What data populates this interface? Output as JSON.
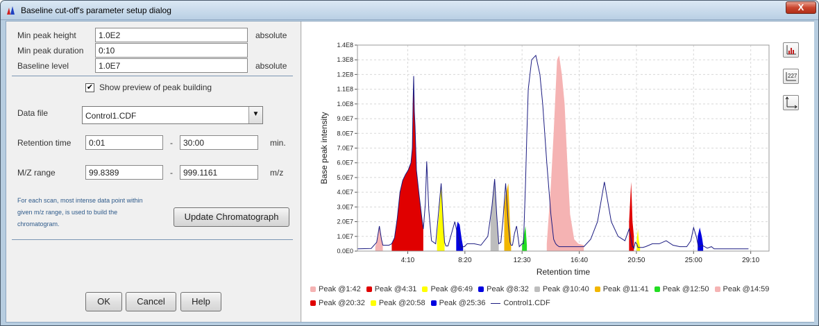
{
  "window": {
    "title": "Baseline cut-off's parameter setup dialog",
    "close_label": "X"
  },
  "form": {
    "min_peak_height": {
      "label": "Min peak height",
      "value": "1.0E2",
      "unit": "absolute"
    },
    "min_peak_duration": {
      "label": "Min peak duration",
      "value": "0:10"
    },
    "baseline_level": {
      "label": "Baseline level",
      "value": "1.0E7",
      "unit": "absolute"
    },
    "show_preview": {
      "label": "Show preview of peak building",
      "checked": true
    },
    "data_file": {
      "label": "Data file",
      "value": "Control1.CDF"
    },
    "retention_time": {
      "label": "Retention time",
      "from": "0:01",
      "sep": "-",
      "to": "30:00",
      "unit": "min."
    },
    "mz_range": {
      "label": "M/Z range",
      "from": "99.8389",
      "sep": "-",
      "to": "999.1161",
      "unit": "m/z"
    },
    "note": "For each scan, most intense data point within given m/z range, is used to build the chromatogram.",
    "update_button": "Update Chromatograph"
  },
  "buttons": {
    "ok": "OK",
    "cancel": "Cancel",
    "help": "Help"
  },
  "toolbar": {
    "icons": [
      "peak-labels-icon",
      "data-labels-icon",
      "axes-icon"
    ],
    "data_label_text": "227"
  },
  "chart_data": {
    "type": "area",
    "xlabel": "Retention time",
    "ylabel": "Base peak intensity",
    "xlim": [
      0.5,
      30.5
    ],
    "ylim": [
      0,
      140000000
    ],
    "x_ticks": [
      {
        "v": 4.167,
        "label": "4:10"
      },
      {
        "v": 8.333,
        "label": "8:20"
      },
      {
        "v": 12.5,
        "label": "12:30"
      },
      {
        "v": 16.667,
        "label": "16:40"
      },
      {
        "v": 20.833,
        "label": "20:50"
      },
      {
        "v": 25.0,
        "label": "25:00"
      },
      {
        "v": 29.167,
        "label": "29:10"
      }
    ],
    "y_ticks": [
      "0.0E0",
      "1.0E7",
      "2.0E7",
      "3.0E7",
      "4.0E7",
      "5.0E7",
      "6.0E7",
      "7.0E7",
      "8.0E7",
      "9.0E7",
      "1.0E8",
      "1.1E8",
      "1.2E8",
      "1.3E8",
      "1.4E8"
    ],
    "line_series": {
      "name": "Control1.CDF",
      "color": "#1a1a80",
      "x": [
        0.5,
        1.5,
        1.9,
        2.1,
        2.25,
        2.35,
        2.5,
        2.8,
        3.0,
        3.2,
        3.4,
        3.6,
        3.8,
        4.0,
        4.2,
        4.4,
        4.5,
        4.55,
        4.6,
        4.65,
        4.7,
        4.8,
        5.0,
        5.2,
        5.3,
        5.45,
        5.55,
        5.7,
        5.9,
        6.2,
        6.4,
        6.6,
        6.75,
        6.85,
        6.95,
        7.1,
        7.3,
        7.6,
        7.8,
        8.0,
        8.1,
        8.2,
        8.3,
        8.5,
        9.0,
        9.5,
        10.0,
        10.3,
        10.5,
        10.65,
        10.8,
        10.95,
        11.1,
        11.3,
        11.5,
        11.62,
        11.7,
        11.8,
        11.95,
        12.1,
        12.3,
        12.5,
        12.6,
        12.75,
        12.85,
        12.95,
        13.2,
        13.5,
        13.8,
        14.0,
        14.3,
        14.6,
        14.8,
        14.95,
        15.05,
        15.2,
        15.4,
        15.6,
        15.8,
        16.0,
        16.3,
        16.6,
        17.0,
        17.5,
        18.0,
        18.5,
        19.0,
        19.5,
        20.0,
        20.3,
        20.45,
        20.55,
        20.6,
        20.65,
        20.75,
        20.85,
        20.95,
        21.0,
        21.1,
        21.3,
        21.5,
        22.0,
        22.5,
        23.0,
        23.5,
        24.0,
        24.5,
        24.8,
        25.0,
        25.2,
        25.35,
        25.45,
        25.6,
        25.8,
        26.0,
        26.3,
        26.5,
        27.0,
        27.5,
        28.0,
        28.5,
        29.0,
        29.5,
        30.0,
        30.5
      ],
      "y": [
        1500000,
        1800000,
        6000000,
        17000000,
        8000000,
        4000000,
        4000000,
        4000000,
        5000000,
        9000000,
        22000000,
        40000000,
        48000000,
        52000000,
        55000000,
        60000000,
        70000000,
        100000000,
        119000000,
        95000000,
        85000000,
        55000000,
        38000000,
        22000000,
        15000000,
        32000000,
        61000000,
        28000000,
        7000000,
        5000000,
        25000000,
        46000000,
        20000000,
        6000000,
        3500000,
        3500000,
        10000000,
        20000000,
        11000000,
        3000000,
        2000000,
        3000000,
        3000000,
        5000000,
        5000000,
        4000000,
        10000000,
        30000000,
        49000000,
        25000000,
        5000000,
        6000000,
        20000000,
        46000000,
        18000000,
        6000000,
        4000000,
        4000000,
        12000000,
        17000000,
        3000000,
        5000000,
        5000000,
        45000000,
        80000000,
        110000000,
        130000000,
        133000000,
        120000000,
        100000000,
        60000000,
        25000000,
        8000000,
        5000000,
        4000000,
        3000000,
        3000000,
        3000000,
        3000000,
        3000000,
        3000000,
        3000000,
        3000000,
        8000000,
        20000000,
        47000000,
        20000000,
        10000000,
        7000000,
        15000000,
        8000000,
        3000000,
        3000000,
        2000000,
        6000000,
        5000000,
        2500000,
        2500000,
        2500000,
        2500000,
        3000000,
        5000000,
        5000000,
        7000000,
        4000000,
        3000000,
        3000000,
        7000000,
        16000000,
        10000000,
        3000000,
        3000000,
        4000000,
        3000000,
        2000000,
        3000000,
        1500000,
        1500000,
        1500000,
        1500000,
        1500000,
        1500000
      ],
      "peaks": [
        {
          "label": "Peak @1:42",
          "color": "#f5b3b3",
          "x": [
            1.8,
            2.0,
            2.1,
            2.25,
            2.35
          ],
          "y": [
            3000000,
            10000000,
            17000000,
            8000000,
            4000000
          ]
        },
        {
          "label": "Peak @4:31",
          "color": "#e00000",
          "x": [
            3.0,
            3.2,
            3.4,
            3.6,
            3.8,
            4.0,
            4.2,
            4.4,
            4.5,
            4.55,
            4.6,
            4.65,
            4.7,
            4.8,
            5.0,
            5.2,
            5.3
          ],
          "y": [
            5000000,
            9000000,
            22000000,
            40000000,
            48000000,
            52000000,
            55000000,
            60000000,
            70000000,
            100000000,
            119000000,
            95000000,
            85000000,
            55000000,
            38000000,
            22000000,
            15000000
          ]
        },
        {
          "label": "Peak @6:49",
          "color": "#ffff00",
          "x": [
            6.3,
            6.45,
            6.6,
            6.75,
            6.85
          ],
          "y": [
            10000000,
            25000000,
            46000000,
            20000000,
            6000000
          ]
        },
        {
          "label": "Peak @8:32",
          "color": "#0000e0",
          "x": [
            7.7,
            7.8,
            7.95,
            8.1,
            8.2
          ],
          "y": [
            14000000,
            20000000,
            18000000,
            8000000,
            3000000
          ]
        },
        {
          "label": "Peak @10:40",
          "color": "#bdbdbd",
          "x": [
            10.2,
            10.3,
            10.5,
            10.65,
            10.8
          ],
          "y": [
            20000000,
            30000000,
            49000000,
            25000000,
            5000000
          ]
        },
        {
          "label": "Peak @11:41",
          "color": "#f2b600",
          "x": [
            11.2,
            11.3,
            11.5,
            11.62,
            11.7
          ],
          "y": [
            30000000,
            38000000,
            46000000,
            18000000,
            6000000
          ]
        },
        {
          "label": "Peak @12:50",
          "color": "#22dd22",
          "x": [
            12.5,
            12.6,
            12.75,
            12.85
          ],
          "y": [
            4000000,
            9000000,
            17000000,
            4000000
          ]
        },
        {
          "label": "Peak @14:59",
          "color": "#f5b3b3",
          "x": [
            14.3,
            14.6,
            14.8,
            14.95,
            15.05,
            15.2,
            15.4,
            15.6,
            15.8,
            16.0,
            16.3,
            16.6,
            17.0
          ],
          "y": [
            5000000,
            45000000,
            80000000,
            110000000,
            130000000,
            133000000,
            120000000,
            100000000,
            60000000,
            25000000,
            8000000,
            5000000,
            4000000
          ]
        },
        {
          "label": "Peak @20:32",
          "color": "#e00000",
          "x": [
            20.3,
            20.45,
            20.55,
            20.65
          ],
          "y": [
            20000000,
            47000000,
            20000000,
            10000000
          ]
        },
        {
          "label": "Peak @20:58",
          "color": "#ffff00",
          "x": [
            20.85,
            20.95,
            21.0,
            21.1
          ],
          "y": [
            7000000,
            15000000,
            8000000,
            3000000
          ]
        },
        {
          "label": "Peak @25:36",
          "color": "#0000e0",
          "x": [
            25.3,
            25.45,
            25.6,
            25.7
          ],
          "y": [
            10000000,
            16000000,
            10000000,
            4000000
          ]
        }
      ]
    },
    "legend": [
      "Peak @1:42",
      "Peak @4:31",
      "Peak @6:49",
      "Peak @8:32",
      "Peak @10:40",
      "Peak @11:41",
      "Peak @12:50",
      "Peak @14:59",
      "Peak @20:32",
      "Peak @20:58",
      "Peak @25:36",
      "Control1.CDF"
    ],
    "grid": true,
    "legend_position": "bottom"
  }
}
